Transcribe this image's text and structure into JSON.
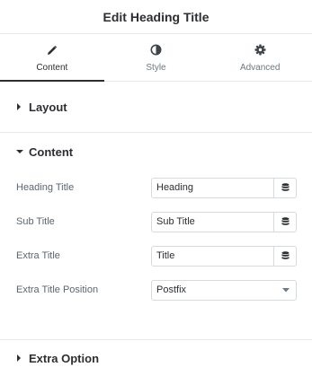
{
  "header": {
    "title": "Edit Heading Title"
  },
  "tabs": [
    {
      "label": "Content",
      "icon": "pencil-icon",
      "active": true
    },
    {
      "label": "Style",
      "icon": "contrast-icon",
      "active": false
    },
    {
      "label": "Advanced",
      "icon": "gear-icon",
      "active": false
    }
  ],
  "sections": {
    "layout": {
      "label": "Layout",
      "expanded": false
    },
    "content": {
      "label": "Content",
      "expanded": true
    },
    "extra_option": {
      "label": "Extra Option",
      "expanded": false
    }
  },
  "fields": [
    {
      "label": "Heading Title",
      "value": "Heading",
      "control": "text-with-dynamic"
    },
    {
      "label": "Sub Title",
      "value": "Sub Title",
      "control": "text-with-dynamic"
    },
    {
      "label": "Extra Title",
      "value": "Title",
      "control": "text-with-dynamic"
    },
    {
      "label": "Extra Title Position",
      "value": "Postfix",
      "control": "select"
    }
  ],
  "colors": {
    "text": "#2c2e31",
    "muted": "#6d7882",
    "border": "#d5dadf",
    "divider": "#e6e8ea"
  }
}
